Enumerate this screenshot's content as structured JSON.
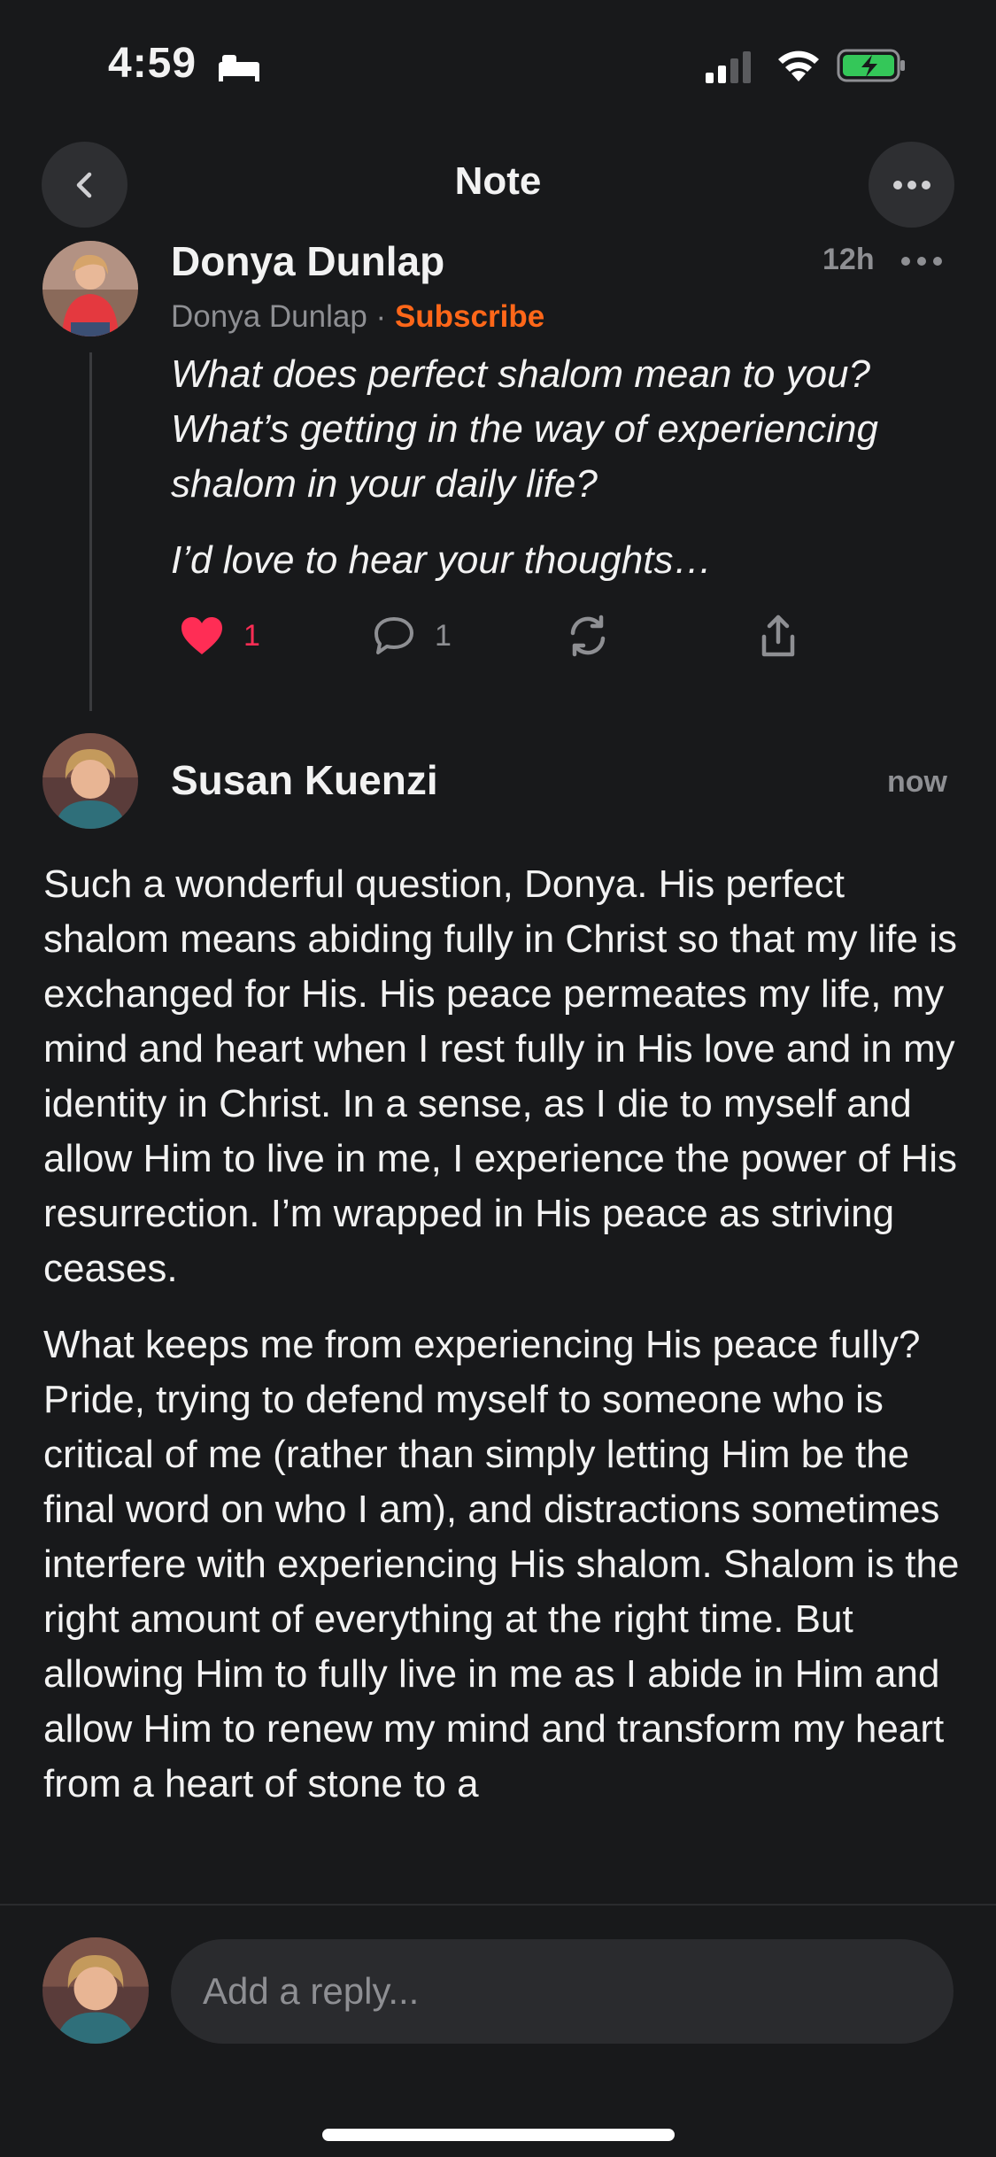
{
  "status_bar": {
    "time": "4:59"
  },
  "nav": {
    "title": "Note"
  },
  "note": {
    "author": "Donya Dunlap",
    "timestamp": "12h",
    "publication": "Donya Dunlap",
    "separator": "·",
    "subscribe_label": "Subscribe",
    "paragraphs": [
      "What does perfect shalom mean to you? What’s getting in the way of experiencing shalom in your daily life?",
      "I’d love to hear your thoughts…"
    ],
    "likes": "1",
    "comments": "1"
  },
  "reply": {
    "author": "Susan Kuenzi",
    "timestamp": "now",
    "paragraphs": [
      "Such a wonderful question, Donya. His perfect shalom means abiding fully in Christ so that my life is exchanged for His. His peace permeates my life, my mind and heart when I rest fully in His love and in my identity in Christ. In a sense, as I die to myself and allow Him to live in me, I experience the power of His resurrection. I’m wrapped in His peace as striving ceases.",
      "What keeps me from experiencing His peace fully? Pride, trying to defend myself to someone who is critical of me (rather than simply letting Him be the final word on who I am), and distractions sometimes interfere with experiencing His shalom. Shalom is the right amount of everything at the right time. But allowing Him to fully live in me as I abide in Him and allow Him to renew my mind and transform my heart from a heart of stone to a"
    ]
  },
  "composer": {
    "placeholder": "Add a reply..."
  },
  "colors": {
    "accent": "#ff6719",
    "like": "#ff2d55",
    "background": "#18191b"
  }
}
